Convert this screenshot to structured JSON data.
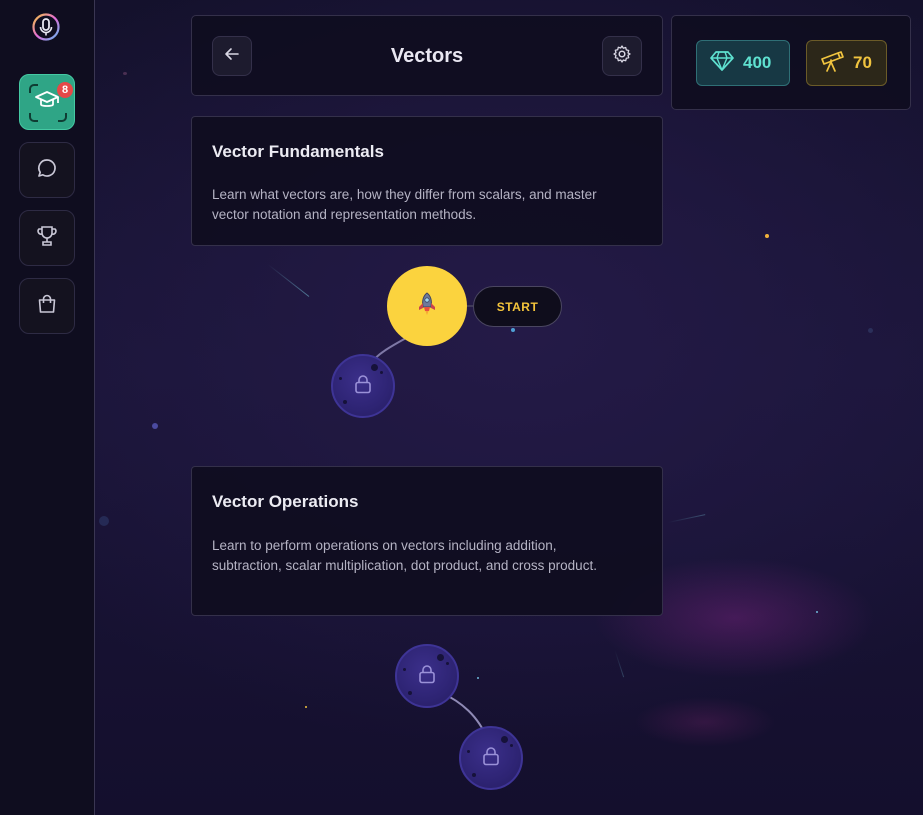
{
  "header": {
    "title": "Vectors",
    "back_icon": "arrow-left-icon",
    "settings_icon": "gear-icon"
  },
  "currencies": {
    "gems": {
      "value": "400",
      "icon": "diamond-icon",
      "color": "#5fe1d0"
    },
    "telescopes": {
      "value": "70",
      "icon": "telescope-icon",
      "color": "#f1c43f"
    }
  },
  "sidebar": {
    "logo_icon": "microphone-logo-icon",
    "items": [
      {
        "name": "learn",
        "icon": "graduation-cap-icon",
        "badge": "8",
        "active": true
      },
      {
        "name": "chat",
        "icon": "chat-bubble-icon"
      },
      {
        "name": "leaderboard",
        "icon": "trophy-icon"
      },
      {
        "name": "shop",
        "icon": "shopping-bag-icon"
      }
    ]
  },
  "units": [
    {
      "title": "Vector Fundamentals",
      "description": "Learn what vectors are, how they differ from scalars, and master vector notation and representation methods."
    },
    {
      "title": "Vector Operations",
      "description": "Learn to perform operations on vectors including addition, subtraction, scalar multiplication, dot product, and cross product."
    }
  ],
  "path": {
    "start_label": "START",
    "start_icon": "rocket-icon",
    "locked_icon": "lock-icon"
  },
  "colors": {
    "accent_green": "#2fa586",
    "start_yellow": "#fbd33e",
    "badge_red": "#e54848",
    "locked_purple": "#2e2474"
  }
}
